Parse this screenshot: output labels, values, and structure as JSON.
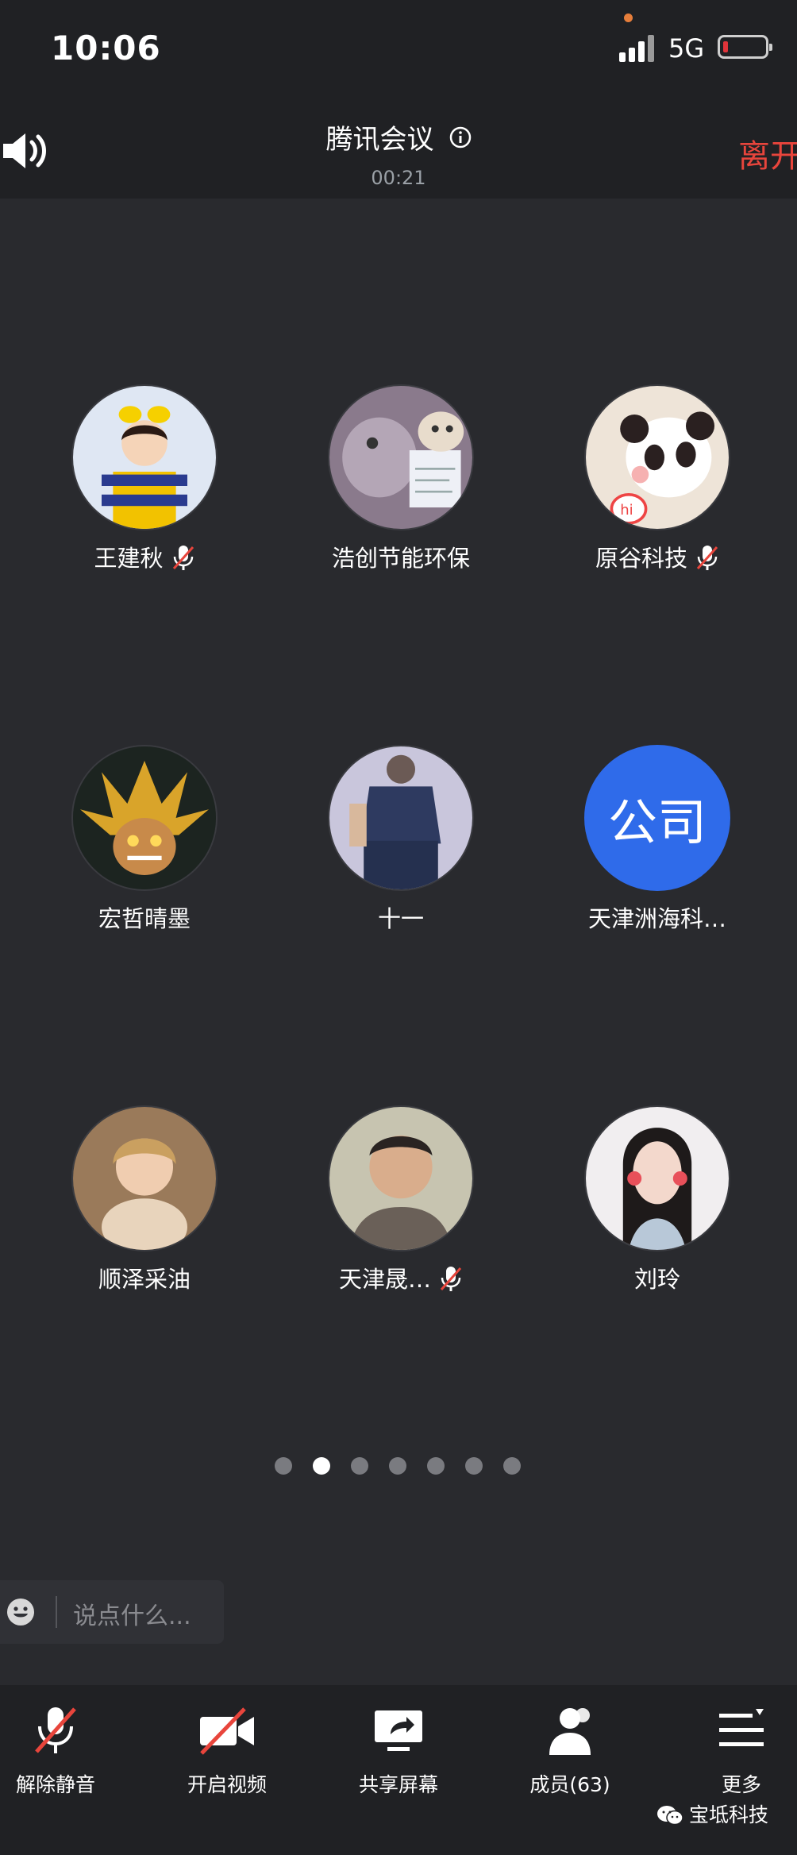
{
  "status_bar": {
    "time": "10:06",
    "network": "5G"
  },
  "header": {
    "title": "腾讯会议",
    "timer": "00:21",
    "leave_label": "离开"
  },
  "participants": [
    {
      "name": "王建秋",
      "muted": true
    },
    {
      "name": "浩创节能环保",
      "muted": false
    },
    {
      "name": "原谷科技",
      "muted": true
    },
    {
      "name": "宏哲晴墨",
      "muted": false
    },
    {
      "name": "十一",
      "muted": false
    },
    {
      "name": "天津洲海科…",
      "muted": false,
      "avatar_text": "公司"
    },
    {
      "name": "顺泽采油",
      "muted": false
    },
    {
      "name": "天津晟…",
      "muted": true
    },
    {
      "name": "刘玲",
      "muted": false
    }
  ],
  "pagination": {
    "pages": 7,
    "current": 2
  },
  "chat": {
    "placeholder": "说点什么..."
  },
  "toolbar": {
    "unmute": "解除静音",
    "video": "开启视频",
    "share": "共享屏幕",
    "members": "成员(63)",
    "more": "更多"
  },
  "watermark": "宝坻科技",
  "colors": {
    "leave": "#e8453c",
    "avatar_blue": "#2f6bea",
    "background": "#292a2e"
  }
}
